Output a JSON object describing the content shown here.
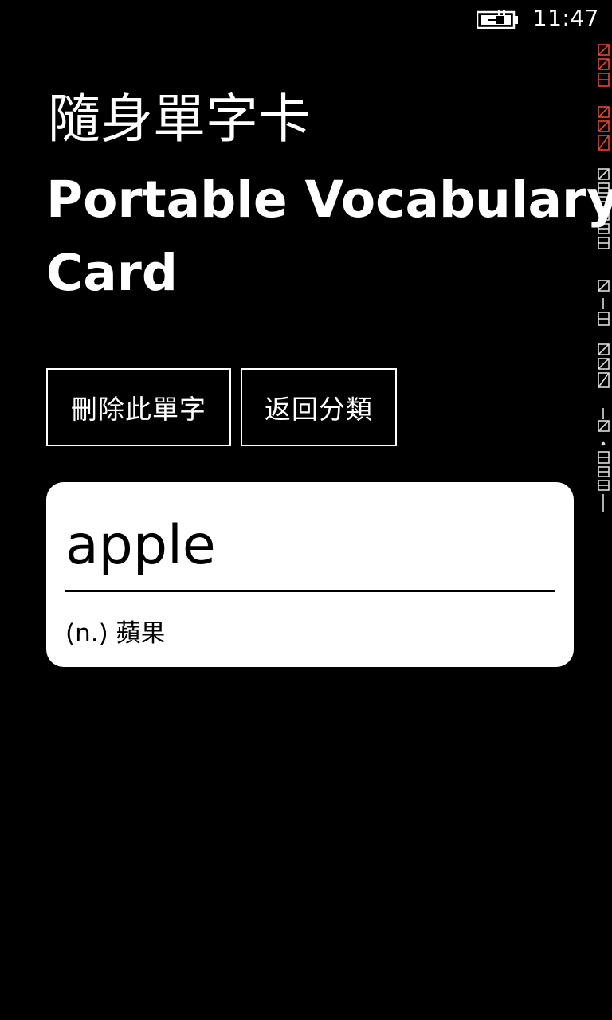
{
  "status_bar": {
    "time": "11:47",
    "battery_icon": "battery-charging-icon"
  },
  "perf_counter": {
    "segments": [
      "008",
      "000",
      "000",
      "00000",
      "000",
      "000",
      "000",
      "0000"
    ]
  },
  "header": {
    "title_zh": "隨身單字卡",
    "title_en_line1": "Portable Vocabulary",
    "title_en_line2": "Card"
  },
  "actions": {
    "delete_label": "刪除此單字",
    "back_label": "返回分類"
  },
  "card": {
    "word": "apple",
    "definition": "(n.) 蘋果"
  },
  "colors": {
    "background": "#000000",
    "foreground": "#ffffff",
    "card_background": "#ffffff",
    "counter_red": "#e8452b"
  }
}
